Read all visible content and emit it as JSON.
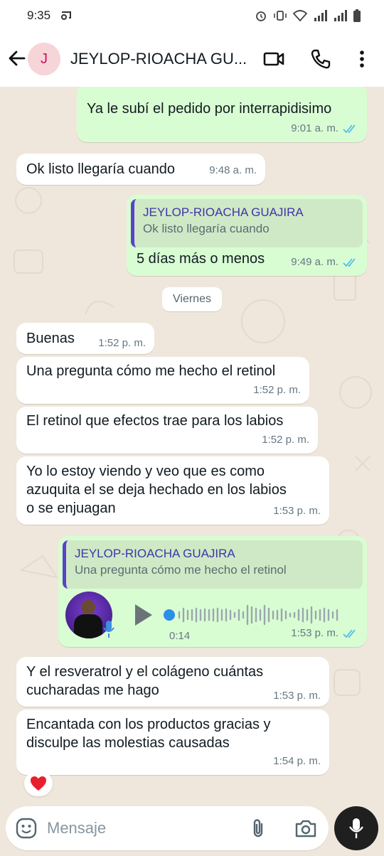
{
  "status_bar": {
    "time": "9:35"
  },
  "header": {
    "avatar_letter": "J",
    "contact_name": "JEYLOP-RIOACHA GU..."
  },
  "messages": [
    {
      "text": "Ya le subí el pedido por interrapidisimo",
      "time": "9:01 a. m."
    },
    {
      "text": "Ok listo llegaría cuando",
      "time": "9:48 a. m."
    },
    {
      "quote_name": "JEYLOP-RIOACHA GUAJIRA",
      "quote_text": "Ok listo llegaría cuando",
      "text": "5 días más o menos",
      "time": "9:49 a. m."
    },
    {
      "text": "Buenas",
      "time": "1:52 p. m."
    },
    {
      "text": "Una pregunta cómo me hecho el retinol",
      "time": "1:52 p. m."
    },
    {
      "text": "El retinol que efectos trae para los labios",
      "time": "1:52 p. m."
    },
    {
      "line1": "Yo lo estoy viendo y veo que es como",
      "line2": "azuquita el se deja hechado en los labios",
      "line3": "o se enjuagan",
      "time": "1:53 p. m."
    },
    {
      "quote_name": "JEYLOP-RIOACHA GUAJIRA",
      "quote_text": "Una pregunta cómo me hecho el retinol",
      "duration": "0:14",
      "time": "1:53 p. m."
    },
    {
      "line1": "Y el resveratrol y el colágeno cuántas",
      "line2": "cucharadas me hago",
      "time": "1:53 p. m."
    },
    {
      "line1": "Encantada con los productos gracias y",
      "line2": "disculpe las molestias causadas",
      "time": "1:54 p. m."
    }
  ],
  "date_chip": "Viernes",
  "composer": {
    "placeholder": "Mensaje"
  },
  "colors": {
    "outgoing": "#d9fdd3",
    "incoming": "#ffffff",
    "read_ticks": "#53bdeb",
    "quote_accent": "#5a43c6"
  },
  "icons": [
    "back-arrow-icon",
    "video-call-icon",
    "phone-icon",
    "more-vert-icon",
    "double-check-icon",
    "play-icon",
    "mic-icon",
    "emoji-icon",
    "attach-icon",
    "camera-icon",
    "heart-icon"
  ]
}
